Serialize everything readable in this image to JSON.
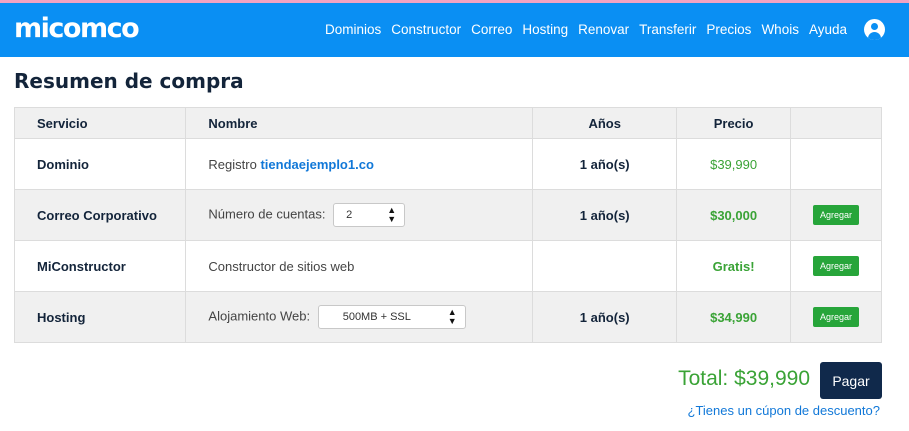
{
  "header": {
    "logo": "micomco",
    "nav": [
      "Dominios",
      "Constructor",
      "Correo",
      "Hosting",
      "Renovar",
      "Transferir",
      "Precios",
      "Whois",
      "Ayuda"
    ]
  },
  "page": {
    "title": "Resumen de compra"
  },
  "table": {
    "headers": [
      "Servicio",
      "Nombre",
      "Años",
      "Precio",
      ""
    ],
    "rows": [
      {
        "service": "Dominio",
        "name_prefix": "Registro",
        "domain": "tiendaejemplo1.co",
        "years": "1 año(s)",
        "price": "$39,990"
      },
      {
        "service": "Correo Corporativo",
        "name_label": "Número de cuentas:",
        "select_value": "2",
        "years": "1 año(s)",
        "price": "$30,000",
        "action": "Agregar"
      },
      {
        "service": "MiConstructor",
        "name": "Constructor de sitios web",
        "years": "",
        "price": "Gratis!",
        "action": "Agregar"
      },
      {
        "service": "Hosting",
        "name_label": "Alojamiento Web:",
        "select_value": "500MB + SSL",
        "years": "1 año(s)",
        "price": "$34,990",
        "action": "Agregar"
      }
    ]
  },
  "summary": {
    "total": "Total: $39,990",
    "pay_label": "Pagar",
    "coupon_link": "¿Tienes un cúpon de descuento?"
  },
  "colors": {
    "header_bg": "#0a8ff3",
    "price_green": "#3aa336",
    "button_green": "#27a53a",
    "pay_navy": "#10294b",
    "link_blue": "#1178d8"
  },
  "icons": {
    "user": "user-circle-icon",
    "select_arrows": "sort-arrows-icon"
  }
}
